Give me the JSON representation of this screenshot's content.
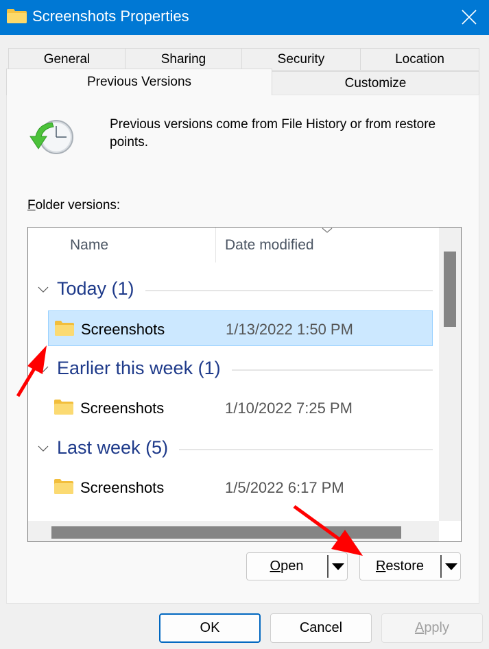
{
  "window": {
    "title": "Screenshots Properties",
    "title_icon": "folder-icon",
    "close_icon": "close-icon"
  },
  "tabs": [
    {
      "label": "General",
      "active": false
    },
    {
      "label": "Sharing",
      "active": false
    },
    {
      "label": "Security",
      "active": false
    },
    {
      "label": "Location",
      "active": false
    },
    {
      "label": "Previous Versions",
      "active": true
    },
    {
      "label": "Customize",
      "active": false
    }
  ],
  "panel": {
    "icon": "restore-clock-icon",
    "description": "Previous versions come from File History or from restore points.",
    "folder_versions_label_accel": "F",
    "folder_versions_label_rest": "older versions:"
  },
  "list": {
    "columns": [
      "Name",
      "Date modified"
    ],
    "sort_indicator": "chevron-down-icon",
    "groups": [
      {
        "label": "Today (1)",
        "items": [
          {
            "name": "Screenshots",
            "date": "1/13/2022 1:50 PM",
            "selected": true
          }
        ]
      },
      {
        "label": "Earlier this week (1)",
        "items": [
          {
            "name": "Screenshots",
            "date": "1/10/2022 7:25 PM",
            "selected": false
          }
        ]
      },
      {
        "label": "Last week (5)",
        "items": [
          {
            "name": "Screenshots",
            "date": "1/5/2022 6:17 PM",
            "selected": false
          }
        ]
      }
    ]
  },
  "actions": {
    "open_accel": "O",
    "open_rest": "pen",
    "restore_accel": "R",
    "restore_rest": "estore"
  },
  "footer": {
    "ok": "OK",
    "cancel": "Cancel",
    "apply_accel": "A",
    "apply_rest": "pply"
  },
  "colors": {
    "titlebar": "#0078d4",
    "group_header": "#1e3a8a",
    "selection": "#cce8ff",
    "annotation_arrow": "#ff0000"
  }
}
